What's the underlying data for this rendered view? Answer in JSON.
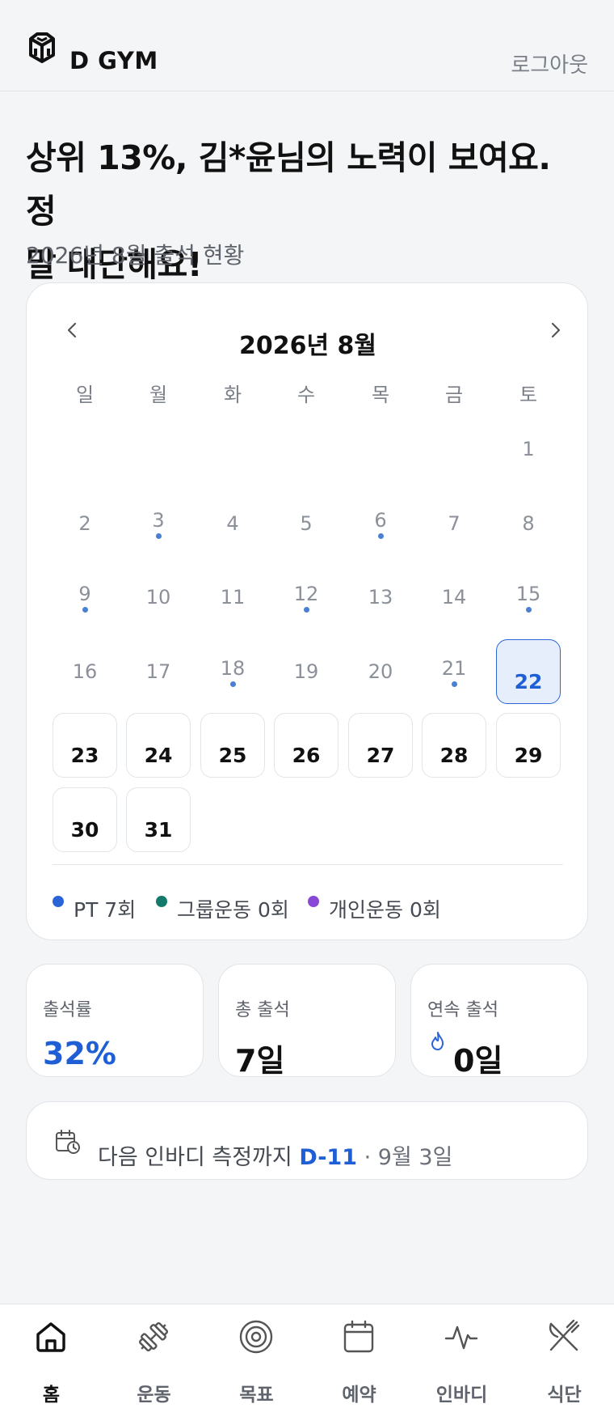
{
  "header": {
    "brand": "D GYM",
    "logout_label": "로그아웃"
  },
  "headline": {
    "line1": "상위 13%, 김*윤님의 노력이 보여요. 정",
    "line2": "말 대단해요!",
    "subtitle": "2026년 8월 출석 현황"
  },
  "calendar": {
    "title": "2026년 8월",
    "weekdays": [
      "일",
      "월",
      "화",
      "수",
      "목",
      "금",
      "토"
    ],
    "days": [
      {
        "day": "1",
        "state": "past",
        "attended": false
      },
      {
        "day": "2",
        "state": "past",
        "attended": false
      },
      {
        "day": "3",
        "state": "past",
        "attended": true
      },
      {
        "day": "4",
        "state": "past",
        "attended": false
      },
      {
        "day": "5",
        "state": "past",
        "attended": false
      },
      {
        "day": "6",
        "state": "past",
        "attended": true
      },
      {
        "day": "7",
        "state": "past",
        "attended": false
      },
      {
        "day": "8",
        "state": "past",
        "attended": false
      },
      {
        "day": "9",
        "state": "past",
        "attended": true
      },
      {
        "day": "10",
        "state": "past",
        "attended": false
      },
      {
        "day": "11",
        "state": "past",
        "attended": false
      },
      {
        "day": "12",
        "state": "past",
        "attended": true
      },
      {
        "day": "13",
        "state": "past",
        "attended": false
      },
      {
        "day": "14",
        "state": "past",
        "attended": false
      },
      {
        "day": "15",
        "state": "past",
        "attended": true
      },
      {
        "day": "16",
        "state": "past",
        "attended": false
      },
      {
        "day": "17",
        "state": "past",
        "attended": false
      },
      {
        "day": "18",
        "state": "past",
        "attended": true
      },
      {
        "day": "19",
        "state": "past",
        "attended": false
      },
      {
        "day": "20",
        "state": "past",
        "attended": false
      },
      {
        "day": "21",
        "state": "past",
        "attended": true
      },
      {
        "day": "22",
        "state": "today",
        "attended": false
      },
      {
        "day": "23",
        "state": "future",
        "attended": false
      },
      {
        "day": "24",
        "state": "future",
        "attended": false
      },
      {
        "day": "25",
        "state": "future",
        "attended": false
      },
      {
        "day": "26",
        "state": "future",
        "attended": false
      },
      {
        "day": "27",
        "state": "future",
        "attended": false
      },
      {
        "day": "28",
        "state": "future",
        "attended": false
      },
      {
        "day": "29",
        "state": "future",
        "attended": false
      },
      {
        "day": "30",
        "state": "future",
        "attended": false
      },
      {
        "day": "31",
        "state": "future",
        "attended": false
      }
    ],
    "first_weekday_index": 6,
    "legend": [
      {
        "label": "PT 7회",
        "color": "#2a64d6"
      },
      {
        "label": "그룹운동 0회",
        "color": "#13796b"
      },
      {
        "label": "개인운동 0회",
        "color": "#8a48d6"
      }
    ],
    "attended_dot_color": "#4a7fd4"
  },
  "stats": {
    "attendance_rate": {
      "label": "출석률",
      "value": "32%"
    },
    "total_attendance": {
      "label": "총 출석",
      "value": "7일"
    },
    "streak": {
      "label": "연속 출석",
      "value": "0일"
    }
  },
  "inbody": {
    "prefix": "다음 인바디 측정까지 ",
    "dday": "D-11",
    "date": " · 9월 3일"
  },
  "nav": {
    "items": [
      {
        "label": "홈",
        "icon": "home-icon",
        "active": true
      },
      {
        "label": "운동",
        "icon": "dumbbell-icon",
        "active": false
      },
      {
        "label": "목표",
        "icon": "target-icon",
        "active": false
      },
      {
        "label": "예약",
        "icon": "calendar-icon",
        "active": false
      },
      {
        "label": "인바디",
        "icon": "pulse-icon",
        "active": false
      },
      {
        "label": "식단",
        "icon": "utensils-icon",
        "active": false
      }
    ]
  }
}
